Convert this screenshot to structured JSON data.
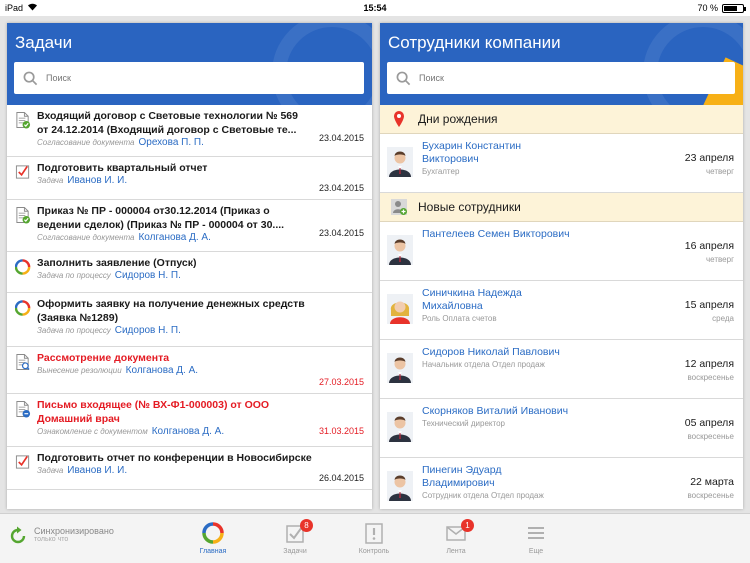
{
  "status_bar": {
    "device": "iPad",
    "time": "15:54",
    "battery": "70 %",
    "battery_level": 0.7
  },
  "colors": {
    "header_blue": "#2a64c0",
    "link_blue": "#2b6cc4",
    "alert_red": "#e41b23",
    "accent_yellow": "#f7b016",
    "section_bg": "#fdf3d8"
  },
  "tasks": {
    "title": "Задачи",
    "search_placeholder": "Поиск",
    "items": [
      {
        "icon": "document-check-icon",
        "title": "Входящий договор с Световые технологии № 569 от 24.12.2014  (Входящий договор с Световые те...",
        "type": "Согласование документа",
        "person": "Орехова П. П.",
        "date": "23.04.2015",
        "urgent": false
      },
      {
        "icon": "task-check-icon",
        "title": "Подготовить квартальный отчет",
        "type": "Задача",
        "person": "Иванов И. И.",
        "date": "23.04.2015",
        "urgent": false
      },
      {
        "icon": "document-check-icon",
        "title": "Приказ № ПР - 000004 от30.12.2014 (Приказ о ведении сделок) (Приказ № ПР - 000004 от 30....",
        "type": "Согласование документа",
        "person": "Колганова Д. А.",
        "date": "23.04.2015",
        "urgent": false
      },
      {
        "icon": "process-ring-icon",
        "title": "Заполнить заявление (Отпуск)",
        "type": "Задача по процессу",
        "person": "Сидоров Н. П.",
        "date": "",
        "urgent": false
      },
      {
        "icon": "process-ring-icon",
        "title": "Оформить заявку на получение денежных средств (Заявка №1289)",
        "type": "Задача по процессу",
        "person": "Сидоров Н. П.",
        "date": "",
        "urgent": false
      },
      {
        "icon": "document-search-icon",
        "title": "Рассмотрение документа",
        "type": "Вынесение резолюции",
        "person": "Колганова Д. А.",
        "date": "27.03.2015",
        "urgent": true
      },
      {
        "icon": "document-info-icon",
        "title": "Письмо входящее (№ ВХ-Ф1-000003) от ООО Домашний врач",
        "type": "Ознакомление с документом",
        "person": "Колганова Д. А.",
        "date": "31.03.2015",
        "urgent": true
      },
      {
        "icon": "task-check-icon",
        "title": "Подготовить отчет по конференции в Новосибирске",
        "type": "Задача",
        "person": "Иванов И. И.",
        "date": "26.04.2015",
        "urgent": false
      }
    ]
  },
  "employees": {
    "title": "Сотрудники компании",
    "search_placeholder": "Поиск",
    "birthdays_title": "Дни рождения",
    "birthdays": [
      {
        "name": "Бухарин Константин Викторович",
        "role": "Бухгалтер",
        "date": "23 апреля",
        "day": "четверг"
      }
    ],
    "new_title": "Новые сотрудники",
    "new_items": [
      {
        "name": "Пантелеев Семен Викторович",
        "role": "",
        "date": "16 апреля",
        "day": "четверг"
      },
      {
        "name": "Синичкина Надежда Михайловна",
        "role": "Роль Оплата счетов",
        "date": "15 апреля",
        "day": "среда"
      },
      {
        "name": "Сидоров Николай Павлович",
        "role": "Начальник отдела Отдел продаж",
        "date": "12 апреля",
        "day": "воскресенье"
      },
      {
        "name": "Скорняков Виталий Иванович",
        "role": "Технический директор",
        "date": "05 апреля",
        "day": "воскресенье"
      },
      {
        "name": "Пинегин Эдуард Владимирович",
        "role": "Сотрудник отдела Отдел продаж",
        "date": "22 марта",
        "day": "воскресенье"
      }
    ]
  },
  "tabbar": {
    "sync_label": "Синхронизировано",
    "sync_sub": "только что",
    "tabs": [
      {
        "label": "Главная",
        "icon": "home-ring-icon",
        "badge": "",
        "active": true
      },
      {
        "label": "Задачи",
        "icon": "tasks-icon",
        "badge": "8",
        "active": false
      },
      {
        "label": "Контроль",
        "icon": "control-icon",
        "badge": "",
        "active": false
      },
      {
        "label": "Лента",
        "icon": "feed-icon",
        "badge": "1",
        "active": false
      },
      {
        "label": "Еще",
        "icon": "menu-icon",
        "badge": "",
        "active": false
      }
    ]
  }
}
